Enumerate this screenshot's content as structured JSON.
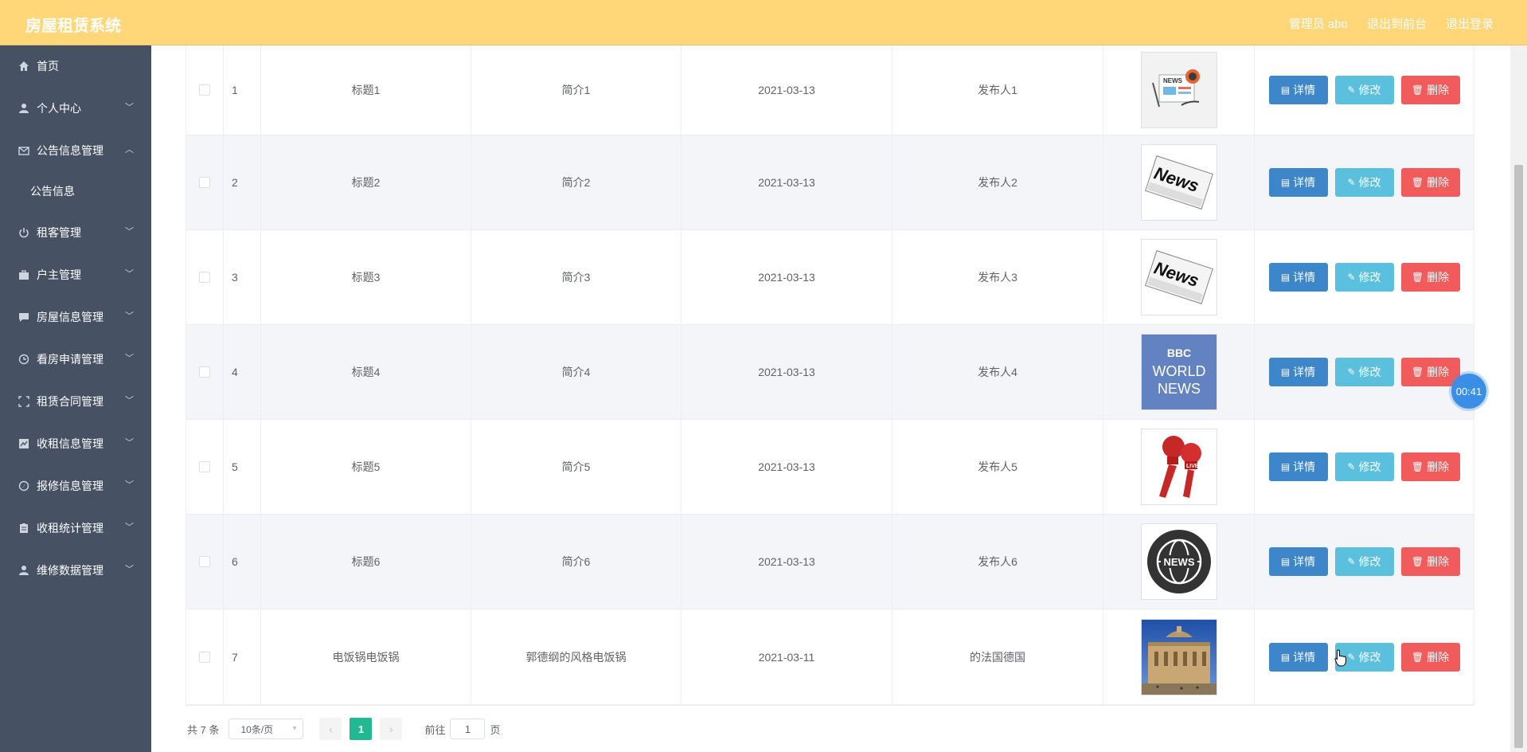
{
  "app": {
    "title": "房屋租赁系统"
  },
  "header": {
    "user_label": "管理员 abo",
    "back_label": "退出到前台",
    "logout_label": "退出登录"
  },
  "sidebar": {
    "items": [
      {
        "label": "首页",
        "icon": "home-icon"
      },
      {
        "label": "个人中心",
        "icon": "user-icon"
      },
      {
        "label": "公告信息管理",
        "icon": "mail-icon",
        "expanded": true
      },
      {
        "label": "租客管理",
        "icon": "power-icon"
      },
      {
        "label": "户主管理",
        "icon": "briefcase-icon"
      },
      {
        "label": "房屋信息管理",
        "icon": "chat-icon"
      },
      {
        "label": "看房申请管理",
        "icon": "clock-icon"
      },
      {
        "label": "租赁合同管理",
        "icon": "fullscreen-icon"
      },
      {
        "label": "收租信息管理",
        "icon": "chart-icon"
      },
      {
        "label": "报修信息管理",
        "icon": "compass-icon"
      },
      {
        "label": "收租统计管理",
        "icon": "clipboard-icon"
      },
      {
        "label": "维修数据管理",
        "icon": "user-icon"
      }
    ],
    "submenu": {
      "label": "公告信息"
    }
  },
  "table": {
    "rows": [
      {
        "index": "1",
        "title": "标题1",
        "intro": "简介1",
        "date": "2021-03-13",
        "publisher": "发布人1",
        "image": "news-illustration"
      },
      {
        "index": "2",
        "title": "标题2",
        "intro": "简介2",
        "date": "2021-03-13",
        "publisher": "发布人2",
        "image": "news-newspaper"
      },
      {
        "index": "3",
        "title": "标题3",
        "intro": "简介3",
        "date": "2021-03-13",
        "publisher": "发布人3",
        "image": "news-newspaper"
      },
      {
        "index": "4",
        "title": "标题4",
        "intro": "简介4",
        "date": "2021-03-13",
        "publisher": "发布人4",
        "image": "bbc-world-news"
      },
      {
        "index": "5",
        "title": "标题5",
        "intro": "简介5",
        "date": "2021-03-13",
        "publisher": "发布人5",
        "image": "live-microphones"
      },
      {
        "index": "6",
        "title": "标题6",
        "intro": "简介6",
        "date": "2021-03-13",
        "publisher": "发布人6",
        "image": "news-globe"
      },
      {
        "index": "7",
        "title": "电饭锅电饭锅",
        "intro": "郭德纲的风格电饭锅",
        "date": "2021-03-11",
        "publisher": "的法国德国",
        "image": "building-photo"
      }
    ],
    "actions": {
      "detail": "详情",
      "edit": "修改",
      "delete": "删除"
    },
    "thumb_text": {
      "news": "News",
      "bbc": "BBC",
      "world": "WORLD",
      "news2": "NEWS",
      "live": "LIVE",
      "small_news": "NEWS"
    }
  },
  "pagination": {
    "total": "共 7 条",
    "page_size": "10条/页",
    "current_page": "1",
    "goto_prefix": "前往",
    "goto_value": "1",
    "goto_suffix": "页"
  },
  "timer": {
    "value": "00:41"
  },
  "colors": {
    "header_bg": "#ffd778",
    "sidebar_bg": "#475164",
    "detail_btn": "#3c86c9",
    "edit_btn": "#5bc0de",
    "delete_btn": "#f25b5b",
    "page_active": "#21b992"
  }
}
